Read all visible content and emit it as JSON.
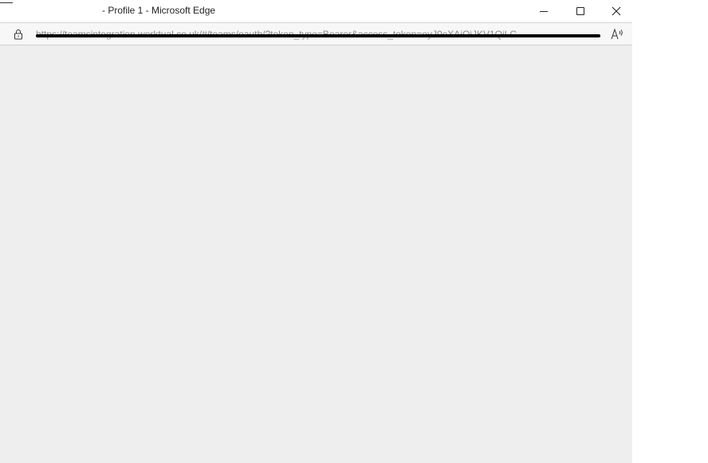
{
  "window": {
    "title": "- Profile 1 - Microsoft Edge"
  },
  "address_bar": {
    "url": "https://teamsintegration.worktual.co.uk/#/teams/oauth/?token_type=Bearer&access_token=eyJ0eXAiOiJKV1QiLC"
  },
  "icons": {
    "lock": "lock-icon",
    "read_aloud": "read-aloud-icon",
    "minimize": "minimize-icon",
    "maximize": "maximize-icon",
    "close": "close-icon"
  }
}
